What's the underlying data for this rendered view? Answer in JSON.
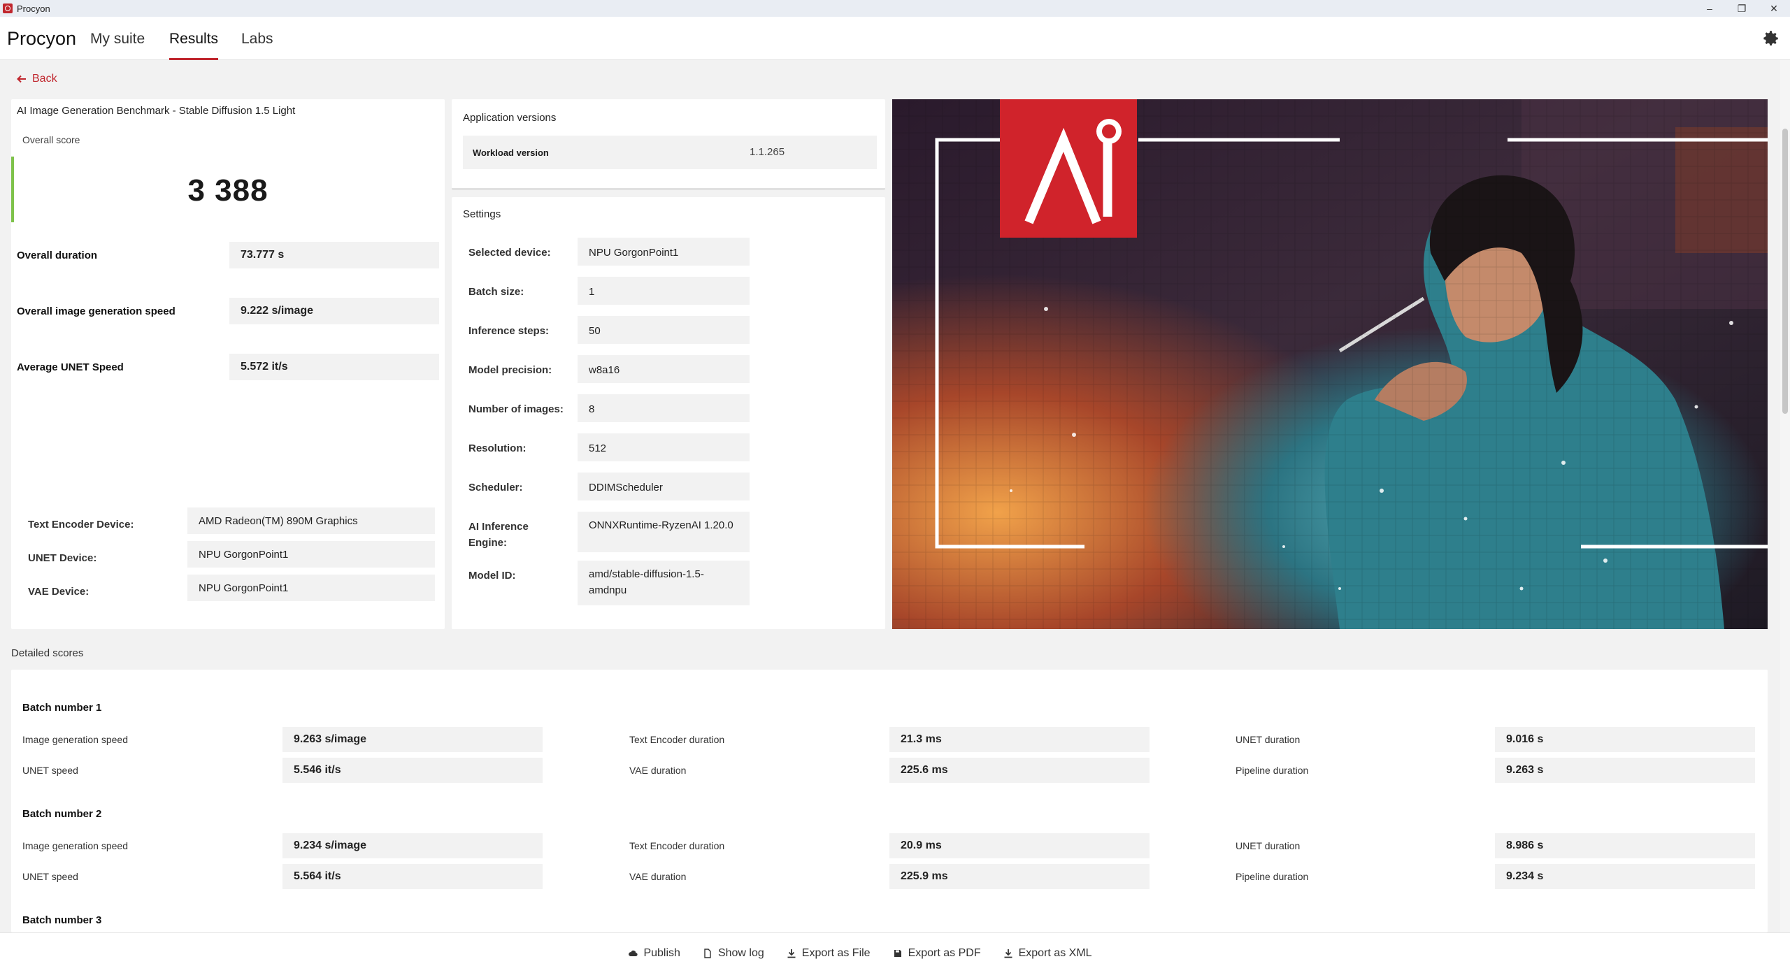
{
  "window": {
    "title": "Procyon"
  },
  "nav": {
    "brand": "Procyon",
    "tabs": [
      "My suite",
      "Results",
      "Labs"
    ]
  },
  "back_label": "Back",
  "score_panel": {
    "benchmark_title": "AI Image Generation Benchmark - Stable Diffusion 1.5 Light",
    "overall_label": "Overall score",
    "overall_score": "3 388",
    "metrics": [
      {
        "label": "Overall duration",
        "value": "73.777 s"
      },
      {
        "label": "Overall image generation speed",
        "value": "9.222 s/image"
      },
      {
        "label": "Average UNET Speed",
        "value": "5.572 it/s"
      }
    ],
    "devices": [
      {
        "label": "Text Encoder Device:",
        "value": "AMD Radeon(TM) 890M Graphics"
      },
      {
        "label": "UNET Device:",
        "value": "NPU GorgonPoint1"
      },
      {
        "label": "VAE Device:",
        "value": "NPU GorgonPoint1"
      }
    ]
  },
  "app_versions": {
    "title": "Application versions",
    "workload_label": "Workload version",
    "workload_value": "1.1.265"
  },
  "settings": {
    "title": "Settings",
    "items": [
      {
        "label": "Selected device:",
        "value": "NPU GorgonPoint1"
      },
      {
        "label": "Batch size:",
        "value": "1"
      },
      {
        "label": "Inference steps:",
        "value": "50"
      },
      {
        "label": "Model precision:",
        "value": "w8a16"
      },
      {
        "label": "Number of images:",
        "value": "8"
      },
      {
        "label": "Resolution:",
        "value": "512"
      },
      {
        "label": "Scheduler:",
        "value": "DDIMScheduler"
      },
      {
        "label": "AI Inference Engine:",
        "value": "ONNXRuntime-RyzenAI 1.20.0"
      },
      {
        "label": "Model ID:",
        "value": "amd/stable-diffusion-1.5-amdnpu"
      }
    ]
  },
  "detailed": {
    "title": "Detailed scores",
    "batches": [
      {
        "title": "Batch number 1",
        "rows": [
          [
            {
              "label": "Image generation speed",
              "value": "9.263 s/image"
            },
            {
              "label": "Text Encoder duration",
              "value": "21.3 ms"
            },
            {
              "label": "UNET duration",
              "value": "9.016 s"
            }
          ],
          [
            {
              "label": "UNET speed",
              "value": "5.546 it/s"
            },
            {
              "label": "VAE duration",
              "value": "225.6 ms"
            },
            {
              "label": "Pipeline duration",
              "value": "9.263 s"
            }
          ]
        ]
      },
      {
        "title": "Batch number 2",
        "rows": [
          [
            {
              "label": "Image generation speed",
              "value": "9.234 s/image"
            },
            {
              "label": "Text Encoder duration",
              "value": "20.9 ms"
            },
            {
              "label": "UNET duration",
              "value": "8.986 s"
            }
          ],
          [
            {
              "label": "UNET speed",
              "value": "5.564 it/s"
            },
            {
              "label": "VAE duration",
              "value": "225.9 ms"
            },
            {
              "label": "Pipeline duration",
              "value": "9.234 s"
            }
          ]
        ]
      },
      {
        "title": "Batch number 3",
        "rows": []
      }
    ]
  },
  "footer": {
    "buttons": [
      "Publish",
      "Show log",
      "Export as File",
      "Export as PDF",
      "Export as XML"
    ]
  },
  "colors": {
    "accent": "#c0262d",
    "score_bar": "#7ec24a",
    "field_bg": "#f2f2f2"
  }
}
